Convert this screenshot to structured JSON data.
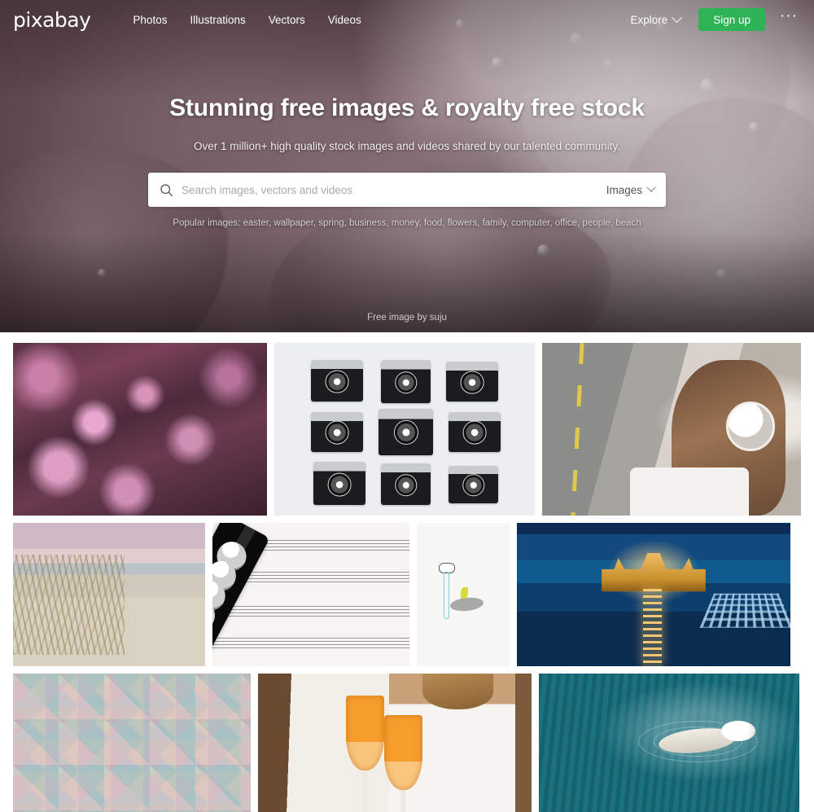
{
  "header": {
    "logo": "pixabay",
    "nav": [
      {
        "label": "Photos"
      },
      {
        "label": "Illustrations"
      },
      {
        "label": "Vectors"
      },
      {
        "label": "Videos"
      }
    ],
    "explore_label": "Explore",
    "explore_chevron_icon": "chevron-down-icon",
    "signup_label": "Sign up",
    "signup_color": "#2eb457",
    "more_menu_icon": "ellipsis-icon",
    "more_menu_label": "···"
  },
  "hero": {
    "title": "Stunning free images & royalty free stock",
    "subtitle": "Over 1 million+ high quality stock images and videos shared by our talented community.",
    "credit": "Free image by suju",
    "search": {
      "icon": "search-icon",
      "placeholder": "Search images, vectors and videos",
      "value": "",
      "type_selected": "Images",
      "type_chevron_icon": "chevron-down-icon"
    },
    "popular": {
      "label": "Popular images:",
      "tags": [
        "easter",
        "wallpaper",
        "spring",
        "business",
        "money",
        "food",
        "flowers",
        "family",
        "computer",
        "office",
        "people",
        "beach"
      ]
    }
  },
  "grid": {
    "rows": [
      {
        "tiles": [
          {
            "name": "tile-pink-flowers",
            "alt": "Pink aster flowers close up"
          },
          {
            "name": "tile-vintage-cameras",
            "alt": "Nine vintage film cameras on white"
          },
          {
            "name": "tile-headphones-girl",
            "alt": "Girl with white headphones on road"
          }
        ]
      },
      {
        "tiles": [
          {
            "name": "tile-beach-dunes",
            "alt": "Beach dunes with grass at dusk"
          },
          {
            "name": "tile-clarinet",
            "alt": "Clarinet resting on sheet music"
          },
          {
            "name": "tile-illustration",
            "alt": "Illustration of figure with plant"
          },
          {
            "name": "tile-pier-night",
            "alt": "Illuminated pier at night over blue sea"
          }
        ]
      },
      {
        "tiles": [
          {
            "name": "tile-pastel-tiles",
            "alt": "Pastel diamond shaped wall tiles"
          },
          {
            "name": "tile-toast-drinks",
            "alt": "Two people toasting orange cocktails"
          },
          {
            "name": "tile-polar-bear",
            "alt": "Polar bear swimming in water"
          }
        ]
      }
    ]
  }
}
